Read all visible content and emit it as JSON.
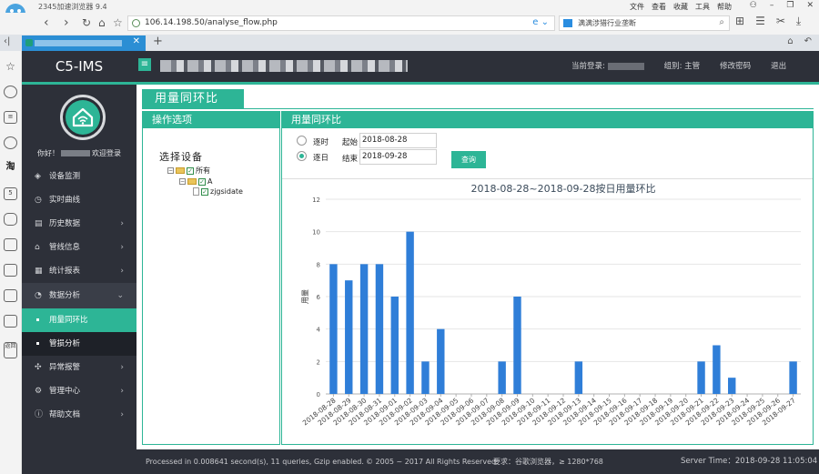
{
  "browser": {
    "title": "2345加速浏览器 9.4",
    "menu": [
      "文件",
      "查看",
      "收藏",
      "工具",
      "帮助"
    ],
    "address": "106.14.198.50/analyse_flow.php",
    "search_text": "满满涉猎行业垄断"
  },
  "header": {
    "brand": "C5-IMS",
    "current_user_label": "当前登录:",
    "group_label": "组别: 主管",
    "change_password": "修改密码",
    "logout": "退出"
  },
  "sidebar": {
    "greeting_prefix": "你好！",
    "greeting_suffix": "欢迎登录",
    "items": [
      {
        "label": "设备监测",
        "icon": "layers-icon",
        "has_arrow": false
      },
      {
        "label": "实时曲线",
        "icon": "clock-icon",
        "has_arrow": false
      },
      {
        "label": "历史数据",
        "icon": "history-icon",
        "has_arrow": true
      },
      {
        "label": "管线信息",
        "icon": "building-icon",
        "has_arrow": true
      },
      {
        "label": "统计报表",
        "icon": "report-icon",
        "has_arrow": true
      },
      {
        "label": "数据分析",
        "icon": "analysis-icon",
        "has_arrow": true,
        "expanded": true
      },
      {
        "label": "异常报警",
        "icon": "alarm-icon",
        "has_arrow": true
      },
      {
        "label": "管理中心",
        "icon": "gear-icon",
        "has_arrow": true
      },
      {
        "label": "帮助文档",
        "icon": "info-icon",
        "has_arrow": true
      }
    ],
    "subitems": [
      {
        "label": "用量同环比",
        "active": true
      },
      {
        "label": "管损分析",
        "active": false
      }
    ]
  },
  "page": {
    "title": "用量同环比",
    "left_panel_title": "操作选项",
    "select_device": "选择设备",
    "tree": [
      {
        "label": "所有",
        "level": 0
      },
      {
        "label": "A",
        "level": 1
      },
      {
        "label": "zjgsidate",
        "level": 2
      }
    ],
    "right_panel_title": "用量同环比",
    "radio_hour": "逐时",
    "radio_day": "逐日",
    "radio_selected": "逐日",
    "start_label": "起始",
    "start_value": "2018-08-28",
    "end_label": "结束",
    "end_value": "2018-09-28",
    "query_button": "查询"
  },
  "chart_data": {
    "type": "bar",
    "title": "2018-08-28~2018-09-28按日用量环比",
    "ylabel": "用量",
    "ylim": [
      0,
      12
    ],
    "yticks": [
      0,
      2,
      4,
      6,
      8,
      10,
      12
    ],
    "categories": [
      "2018-08-28",
      "2018-08-29",
      "2018-08-30",
      "2018-08-31",
      "2018-09-01",
      "2018-09-02",
      "2018-09-03",
      "2018-09-04",
      "2018-09-05",
      "2018-09-06",
      "2018-09-07",
      "2018-09-08",
      "2018-09-09",
      "2018-09-10",
      "2018-09-11",
      "2018-09-12",
      "2018-09-13",
      "2018-09-14",
      "2018-09-15",
      "2018-09-16",
      "2018-09-17",
      "2018-09-18",
      "2018-09-19",
      "2018-09-20",
      "2018-09-21",
      "2018-09-22",
      "2018-09-23",
      "2018-09-24",
      "2018-09-25",
      "2018-09-26",
      "2018-09-27"
    ],
    "values": [
      8,
      7,
      8,
      8,
      6,
      10,
      2,
      4,
      0,
      0,
      0,
      2,
      6,
      0,
      0,
      0,
      2,
      0,
      0,
      0,
      0,
      0,
      0,
      0,
      2,
      3,
      1,
      0,
      0,
      0,
      2
    ],
    "bar_color": "#2f7ed8",
    "grid": "horizontal"
  },
  "footer": {
    "processed": "Processed in 0.008641 second(s), 11 queries, Gzip enabled.",
    "copyright": "© 2005 ~ 2017 All Rights Reserved.",
    "requirement": "要求：谷歌浏览器，≥ 1280*768",
    "server_time": "Server Time：2018-09-28 11:05:04"
  }
}
